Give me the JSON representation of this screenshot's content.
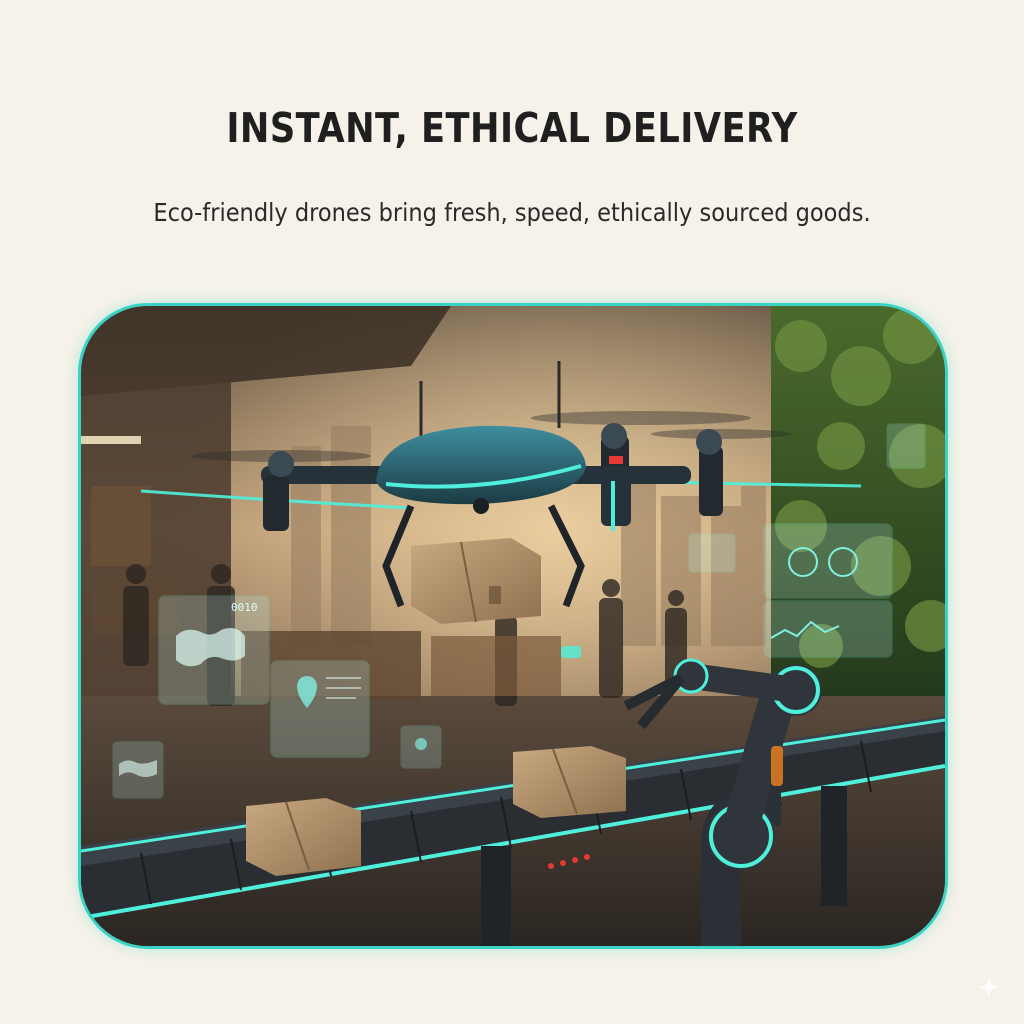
{
  "header": {
    "title": "INSTANT, ETHICAL DELIVERY",
    "subtitle": "Eco-friendly drones bring fresh, speed, ethically sourced goods."
  },
  "colors": {
    "background": "#f6f2e9",
    "accent": "#38d3c4",
    "title_text": "#1f1f1f"
  },
  "scene": {
    "hud_panels": {
      "map_panel_code": "0010"
    }
  },
  "icons": {
    "corner": "sparkle-icon"
  }
}
